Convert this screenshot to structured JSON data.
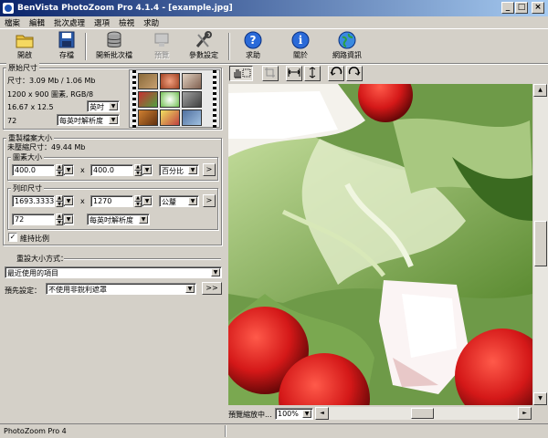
{
  "title": "BenVista PhotoZoom Pro 4.1.4 - [example.jpg]",
  "window_buttons": {
    "minimize": "_",
    "maximize": "□",
    "close": "×"
  },
  "menu": [
    "檔案",
    "編輯",
    "批次處理",
    "選項",
    "檢視",
    "求助"
  ],
  "toolbar": {
    "open": "開啟",
    "save": "存檔",
    "batch": "開新批次檔",
    "preview": "預覽",
    "settings": "參數設定",
    "help": "求助",
    "about": "關於",
    "web": "網路資訊"
  },
  "original": {
    "title": "原始尺寸",
    "size": "尺寸：3.09 Mb / 1.06 Mb",
    "pixels": "1200 x 900 圖素, RGB/8",
    "dims": "16.67 x 12.5",
    "dims_unit": "英吋",
    "res": "72",
    "res_unit": "每英吋解析度"
  },
  "new_size": {
    "title": "重製檔案大小",
    "uncompressed": "未壓縮尺寸：49.44 Mb",
    "pixel_group": "圖素大小",
    "width": "400.0",
    "height": "400.0",
    "unit": "百分比",
    "print_group": "列印尺寸",
    "print_w": "1693.3333",
    "print_h": "1270",
    "print_unit": "公釐",
    "print_res": "72",
    "print_res_unit": "每英吋解析度",
    "x": "x",
    "go": ">",
    "keep_ratio": "維持比例",
    "checkmark": "✓"
  },
  "resize": {
    "title": "重設大小方式：",
    "method": "最近使用的項目",
    "preset_label": "預先設定：",
    "preset": "不使用非銳利遮罩",
    "preset_btn": ">>"
  },
  "zoom": {
    "label": "預覽縮放中...",
    "value": "100%"
  },
  "status": "PhotoZoom Pro 4",
  "scroll": {
    "up": "▲",
    "down": "▼",
    "left": "◄",
    "right": "►"
  },
  "arrow": "▼",
  "spin_up": "▲",
  "spin_down": "▼",
  "colors": {
    "titlebar_start": "#0a246a",
    "titlebar_end": "#a6caf0",
    "face": "#d4d0c8"
  },
  "icons": [
    "folder-icon",
    "floppy-disk-icon",
    "database-icon",
    "preview-icon",
    "tools-icon",
    "help-icon",
    "info-icon",
    "globe-icon",
    "hand-icon",
    "crop-icon",
    "fit-width-icon",
    "fit-height-icon",
    "rotate-left-icon",
    "rotate-right-icon"
  ]
}
